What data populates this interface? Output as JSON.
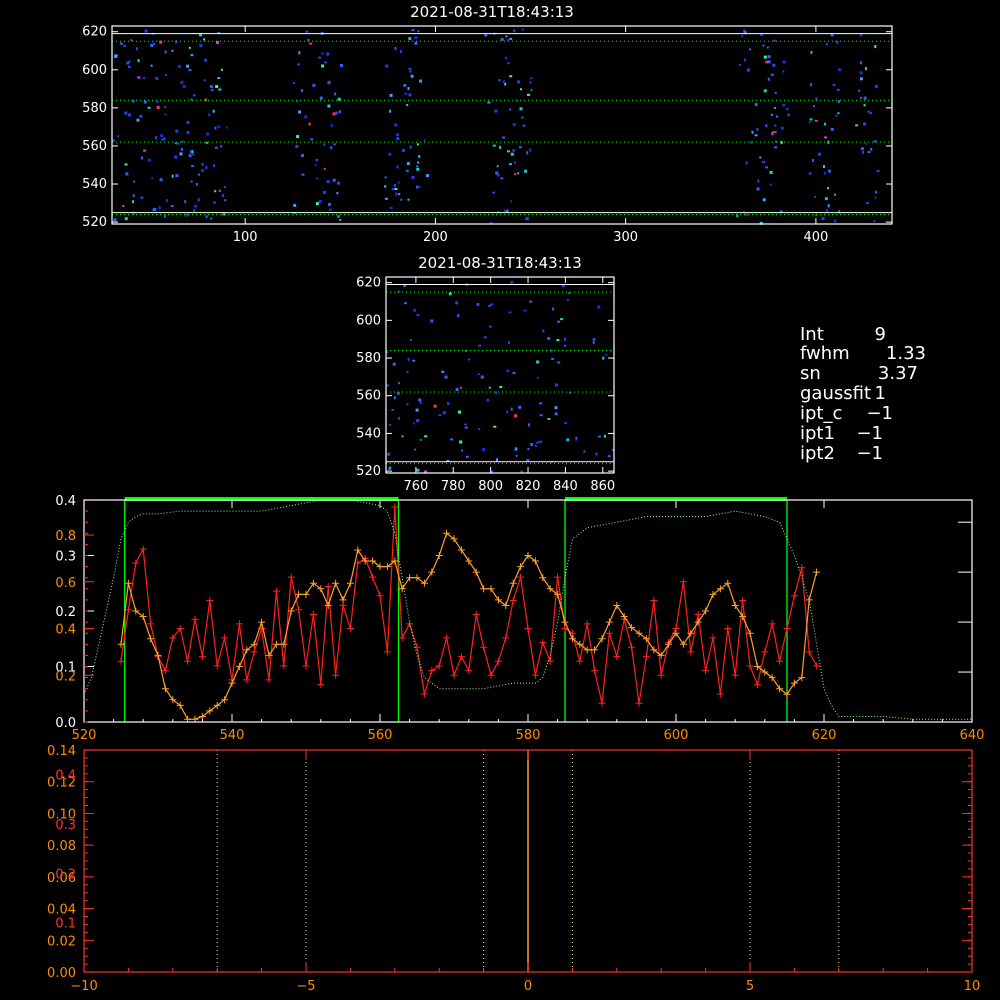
{
  "colors": {
    "background": "#000000",
    "axes": "#ffffff",
    "red_series": "#ff2020",
    "orange_series": "#ffa030",
    "green_guide": "#00ff00",
    "band_lines": "#00ff00",
    "lower_axes": "#ff3030",
    "lower_ticks": "#ff8c00"
  },
  "chart_data": [
    {
      "id": "top-image",
      "type": "heatmap",
      "title": "2021-08-31T18:43:13",
      "xlim": [
        30,
        440
      ],
      "ylim": [
        519,
        623
      ],
      "xticks": [
        100,
        200,
        300,
        400
      ],
      "yticks": [
        520,
        540,
        560,
        580,
        600,
        620
      ],
      "dotted_rows": [
        615,
        584,
        562,
        524
      ],
      "solid_rows": [
        619,
        525
      ],
      "occupied_x_bands": [
        [
          30,
          90
        ],
        [
          125,
          150
        ],
        [
          172,
          195
        ],
        [
          225,
          250
        ],
        [
          358,
          385
        ],
        [
          395,
          412
        ],
        [
          420,
          432
        ]
      ],
      "random_seed": 1
    },
    {
      "id": "zoom-image",
      "type": "heatmap",
      "title": "2021-08-31T18:43:13",
      "xlim": [
        744,
        866
      ],
      "ylim": [
        519,
        623
      ],
      "xticks": [
        760,
        780,
        800,
        820,
        840,
        860
      ],
      "yticks": [
        520,
        540,
        560,
        580,
        600,
        620
      ],
      "dotted_rows": [
        615,
        584,
        562,
        524
      ],
      "solid_rows": [
        619,
        525
      ],
      "occupied_x_bands": [
        [
          744,
          866
        ]
      ],
      "random_seed": 7
    },
    {
      "id": "profile-plot",
      "type": "line",
      "xlim": [
        520,
        640
      ],
      "xticks": [
        520,
        540,
        560,
        580,
        600,
        620,
        640
      ],
      "left_ticks_red": {
        "labels": [
          "0.2",
          "0.4",
          "0.6",
          "0.8"
        ],
        "values": [
          0.2,
          0.4,
          0.6,
          0.8
        ],
        "ylim": [
          0,
          0.95
        ]
      },
      "left_ticks_white": {
        "labels": [
          "0.0",
          "0.1",
          "0.2",
          "0.3",
          "0.4"
        ],
        "values": [
          0.0,
          0.1,
          0.2,
          0.3,
          0.4
        ],
        "ylim": [
          0,
          0.4
        ]
      },
      "green_windows": [
        [
          525.5,
          562.5
        ],
        [
          585,
          615
        ]
      ],
      "series": [
        {
          "color": "red",
          "x": [
            525,
            526,
            527,
            528,
            529,
            530,
            531,
            532,
            533,
            534,
            535,
            536,
            537,
            538,
            539,
            540,
            541,
            542,
            543,
            544,
            545,
            546,
            547,
            548,
            549,
            550,
            551,
            552,
            553,
            554,
            555,
            556,
            557,
            558,
            559,
            560,
            561,
            562,
            563,
            564,
            565,
            566,
            567,
            568,
            569,
            570,
            571,
            572,
            573,
            574,
            575,
            576,
            577,
            578,
            579,
            580,
            581,
            582,
            583,
            584,
            585,
            586,
            587,
            588,
            589,
            590,
            591,
            592,
            593,
            594,
            595,
            596,
            597,
            598,
            599,
            600,
            601,
            602,
            603,
            604,
            605,
            606,
            607,
            608,
            609,
            610,
            611,
            612,
            613,
            614,
            615,
            616,
            617,
            618,
            619
          ],
          "y": [
            0.26,
            0.48,
            0.68,
            0.74,
            0.42,
            0.28,
            0.22,
            0.36,
            0.4,
            0.26,
            0.44,
            0.28,
            0.52,
            0.24,
            0.36,
            0.18,
            0.42,
            0.18,
            0.3,
            0.4,
            0.18,
            0.56,
            0.24,
            0.62,
            0.48,
            0.24,
            0.46,
            0.16,
            0.58,
            0.2,
            0.5,
            0.4,
            0.68,
            0.7,
            0.62,
            0.54,
            0.3,
            0.92,
            0.36,
            0.42,
            0.32,
            0.12,
            0.22,
            0.24,
            0.36,
            0.2,
            0.28,
            0.22,
            0.46,
            0.32,
            0.2,
            0.26,
            0.36,
            0.52,
            0.62,
            0.4,
            0.2,
            0.34,
            0.26,
            0.62,
            0.4,
            0.38,
            0.26,
            0.42,
            0.22,
            0.08,
            0.38,
            0.28,
            0.44,
            0.32,
            0.08,
            0.28,
            0.52,
            0.2,
            0.34,
            0.4,
            0.6,
            0.3,
            0.46,
            0.22,
            0.36,
            0.12,
            0.4,
            0.2,
            0.52,
            0.24,
            0.16,
            0.3,
            0.42,
            0.26,
            0.4,
            0.54,
            0.66,
            0.3,
            0.24
          ]
        },
        {
          "color": "orange",
          "x": [
            525,
            526,
            527,
            528,
            529,
            530,
            531,
            532,
            533,
            534,
            535,
            536,
            537,
            538,
            539,
            540,
            541,
            542,
            543,
            544,
            545,
            546,
            547,
            548,
            549,
            550,
            551,
            552,
            553,
            554,
            555,
            556,
            557,
            558,
            559,
            560,
            561,
            562,
            563,
            564,
            565,
            566,
            567,
            568,
            569,
            570,
            571,
            572,
            573,
            574,
            575,
            576,
            577,
            578,
            579,
            580,
            581,
            582,
            583,
            584,
            585,
            586,
            587,
            588,
            589,
            590,
            591,
            592,
            593,
            594,
            595,
            596,
            597,
            598,
            599,
            600,
            601,
            602,
            603,
            604,
            605,
            606,
            607,
            608,
            609,
            610,
            611,
            612,
            613,
            614,
            615,
            616,
            617,
            618,
            619
          ],
          "y": [
            0.14,
            0.25,
            0.2,
            0.19,
            0.15,
            0.12,
            0.06,
            0.04,
            0.03,
            0.005,
            0.005,
            0.01,
            0.02,
            0.03,
            0.04,
            0.07,
            0.1,
            0.13,
            0.14,
            0.18,
            0.12,
            0.14,
            0.14,
            0.2,
            0.23,
            0.23,
            0.25,
            0.24,
            0.21,
            0.25,
            0.22,
            0.25,
            0.31,
            0.29,
            0.29,
            0.28,
            0.28,
            0.29,
            0.24,
            0.26,
            0.26,
            0.25,
            0.27,
            0.3,
            0.34,
            0.33,
            0.31,
            0.29,
            0.27,
            0.24,
            0.24,
            0.22,
            0.21,
            0.25,
            0.28,
            0.3,
            0.29,
            0.26,
            0.24,
            0.23,
            0.18,
            0.15,
            0.14,
            0.13,
            0.13,
            0.15,
            0.18,
            0.21,
            0.19,
            0.17,
            0.16,
            0.15,
            0.13,
            0.12,
            0.14,
            0.16,
            0.14,
            0.16,
            0.18,
            0.2,
            0.23,
            0.24,
            0.25,
            0.21,
            0.19,
            0.16,
            0.1,
            0.09,
            0.08,
            0.06,
            0.05,
            0.07,
            0.08,
            0.22,
            0.27
          ]
        },
        {
          "color": "green-dotted",
          "x": [
            520,
            521,
            522,
            523,
            524,
            525,
            526,
            527,
            528,
            530,
            533,
            536,
            540,
            544,
            548,
            552,
            556,
            560,
            561,
            562,
            563,
            564,
            565,
            566,
            567,
            568,
            570,
            574,
            578,
            581,
            582,
            583,
            584,
            585,
            586,
            588,
            592,
            596,
            600,
            604,
            608,
            612,
            614,
            615,
            616,
            617,
            618,
            619,
            620,
            621,
            622,
            624,
            628,
            632,
            636,
            640
          ],
          "y": [
            0.05,
            0.08,
            0.14,
            0.2,
            0.26,
            0.33,
            0.36,
            0.37,
            0.375,
            0.375,
            0.38,
            0.38,
            0.38,
            0.38,
            0.39,
            0.4,
            0.4,
            0.39,
            0.38,
            0.34,
            0.26,
            0.18,
            0.12,
            0.08,
            0.07,
            0.06,
            0.06,
            0.06,
            0.07,
            0.07,
            0.08,
            0.12,
            0.18,
            0.26,
            0.33,
            0.35,
            0.36,
            0.37,
            0.37,
            0.37,
            0.38,
            0.37,
            0.36,
            0.33,
            0.3,
            0.26,
            0.22,
            0.14,
            0.06,
            0.03,
            0.01,
            0.01,
            0.01,
            0.005,
            0.005,
            0.005
          ]
        }
      ]
    },
    {
      "id": "spectrum-plot",
      "type": "line",
      "xlim": [
        -10,
        10
      ],
      "xticks": [
        -10,
        -5,
        0,
        5,
        10
      ],
      "left_ticks_white": {
        "labels": [
          "0.00",
          "0.02",
          "0.04",
          "0.06",
          "0.08",
          "0.10",
          "0.12",
          "0.14"
        ],
        "values": [
          0,
          0.02,
          0.04,
          0.06,
          0.08,
          0.1,
          0.12,
          0.14
        ],
        "ylim": [
          0,
          0.14
        ]
      },
      "left_ticks_red": {
        "labels": [
          "0.1",
          "0.2",
          "0.3",
          "0.4"
        ],
        "values": [
          0.1,
          0.2,
          0.3,
          0.4
        ],
        "ylim": [
          0,
          0.45
        ]
      },
      "dotted_verticals": [
        -7,
        -5,
        -1,
        1,
        5,
        7
      ],
      "zero_line": 0
    }
  ],
  "info_panel": [
    {
      "key": "Int",
      "value": "9"
    },
    {
      "key": "fwhm",
      "value": "1.33"
    },
    {
      "key": "sn",
      "value": "3.37"
    },
    {
      "key": "gaussfit",
      "value": "1"
    },
    {
      "key": "ipt_c",
      "value": "−1"
    },
    {
      "key": "ipt1",
      "value": "−1"
    },
    {
      "key": "ipt2",
      "value": "−1"
    }
  ]
}
